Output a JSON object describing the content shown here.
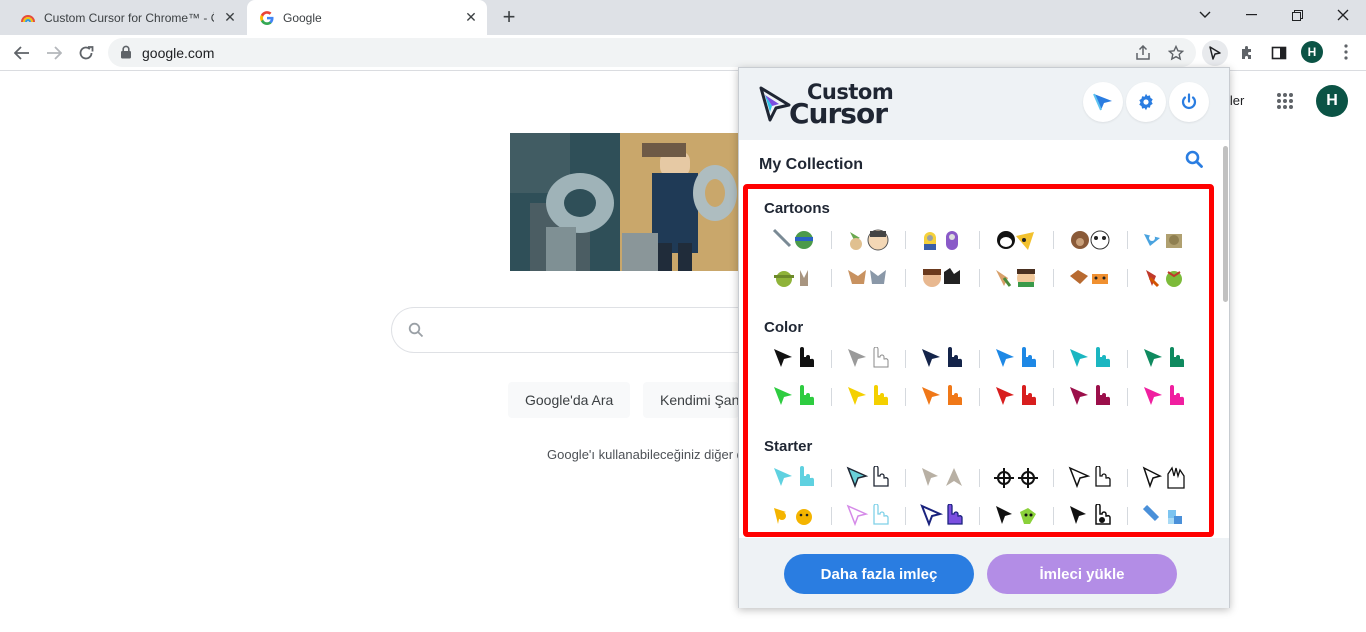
{
  "browser": {
    "tabs": [
      {
        "title": "Custom Cursor for Chrome™ - Ö",
        "active": false
      },
      {
        "title": "Google",
        "active": true
      }
    ],
    "new_tab": "+",
    "window_controls": {
      "minimize": "—",
      "restore": "❐",
      "close": "✕"
    },
    "url": "google.com"
  },
  "google": {
    "search_button": "Google'da Ara",
    "lucky_button": "Kendimi Şan",
    "offer_text": "Google'ı kullanabileceğiniz diğer d",
    "header_link": "ller",
    "avatar_letter": "H"
  },
  "profile_letter": "H",
  "extension": {
    "logo_line1": "Custom",
    "logo_line2": "Cursor",
    "collection_title": "My Collection",
    "categories": [
      {
        "title": "Cartoons"
      },
      {
        "title": "Color"
      },
      {
        "title": "Starter"
      }
    ],
    "more_button": "Daha fazla imleç",
    "upload_button": "İmleci yükle",
    "accent": "#2a7de1",
    "upload_color": "#b38de6",
    "highlight_color": "#ff0000"
  }
}
